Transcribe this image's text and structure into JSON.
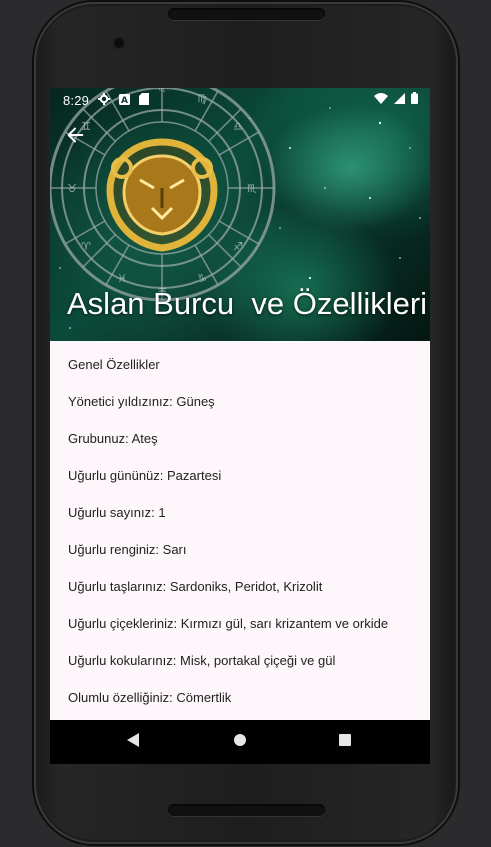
{
  "status_bar": {
    "time": "8:29",
    "left_icons": [
      "gear-icon",
      "a-box-icon",
      "sd-card-icon"
    ],
    "right_icons": [
      "wifi-icon",
      "signal-icon",
      "battery-icon"
    ]
  },
  "header": {
    "title": "Aslan Burcu  ve Özellikleri",
    "back_icon": "arrow-left-icon"
  },
  "list": {
    "items": [
      "Genel Özellikler",
      "Yönetici yıldızınız: Güneş",
      "Grubunuz: Ateş",
      "Uğurlu gününüz: Pazartesi",
      "Uğurlu sayınız: 1",
      "Uğurlu renginiz: Sarı",
      "Uğurlu taşlarınız: Sardoniks, Peridot, Krizolit",
      "Uğurlu çiçekleriniz: Kırmızı gül, sarı krizantem ve orkide",
      "Uğurlu kokularınız: Misk, portakal çiçeği ve gül",
      "Olumlu özelliğiniz: Cömertlik"
    ]
  },
  "nav_bar": {
    "buttons": [
      "back-triangle-icon",
      "home-circle-icon",
      "recents-square-icon"
    ]
  },
  "colors": {
    "screen_bg": "#fdf6fa",
    "hero_green": "#0b4a3a",
    "text": "#222222",
    "nav_bg": "#000000"
  }
}
